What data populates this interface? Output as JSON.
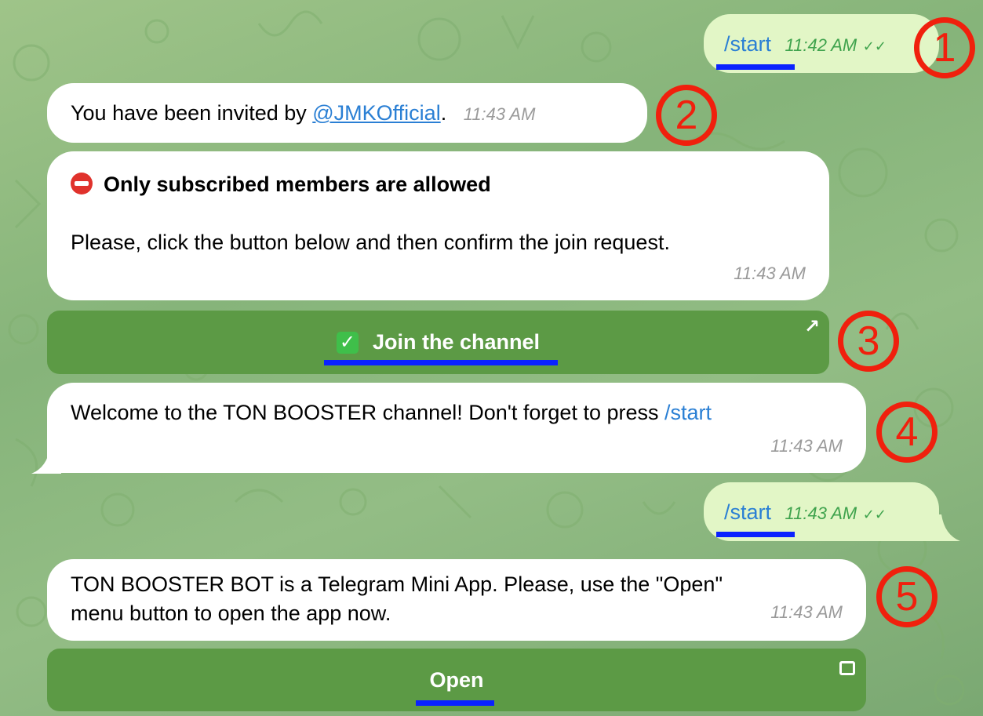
{
  "messages": {
    "m1": {
      "text": "/start",
      "time": "11:42 AM",
      "status": "✓✓"
    },
    "m2": {
      "prefix": "You have been invited by ",
      "mention": "@JMKOfficial",
      "suffix": ".",
      "time": "11:43 AM"
    },
    "m3": {
      "title": "Only subscribed members are allowed",
      "body": "Please, click the button below and then confirm the join request.",
      "time": "11:43 AM"
    },
    "m4": {
      "text": "Welcome to the TON BOOSTER channel! Don't forget to press ",
      "cmd": "/start",
      "time": "11:43 AM"
    },
    "m5": {
      "text": "/start",
      "time": "11:43 AM",
      "status": "✓✓"
    },
    "m6": {
      "line1": "TON BOOSTER BOT is a Telegram Mini App. Please, use the \"Open\"",
      "line2": "menu button to open the app now.",
      "time": "11:43 AM"
    }
  },
  "buttons": {
    "join": {
      "label": "Join the channel",
      "icon": "✓",
      "corner": "↗"
    },
    "open": {
      "label": "Open"
    }
  },
  "annotations": [
    "1",
    "2",
    "3",
    "4",
    "5"
  ],
  "colors": {
    "outgoing_bubble": "#e2f6c6",
    "incoming_bubble": "#ffffff",
    "keyboard_button": "#5c9a45",
    "annotation": "#f0200d",
    "underline": "#0a22ff",
    "link": "#2a7fd4"
  }
}
